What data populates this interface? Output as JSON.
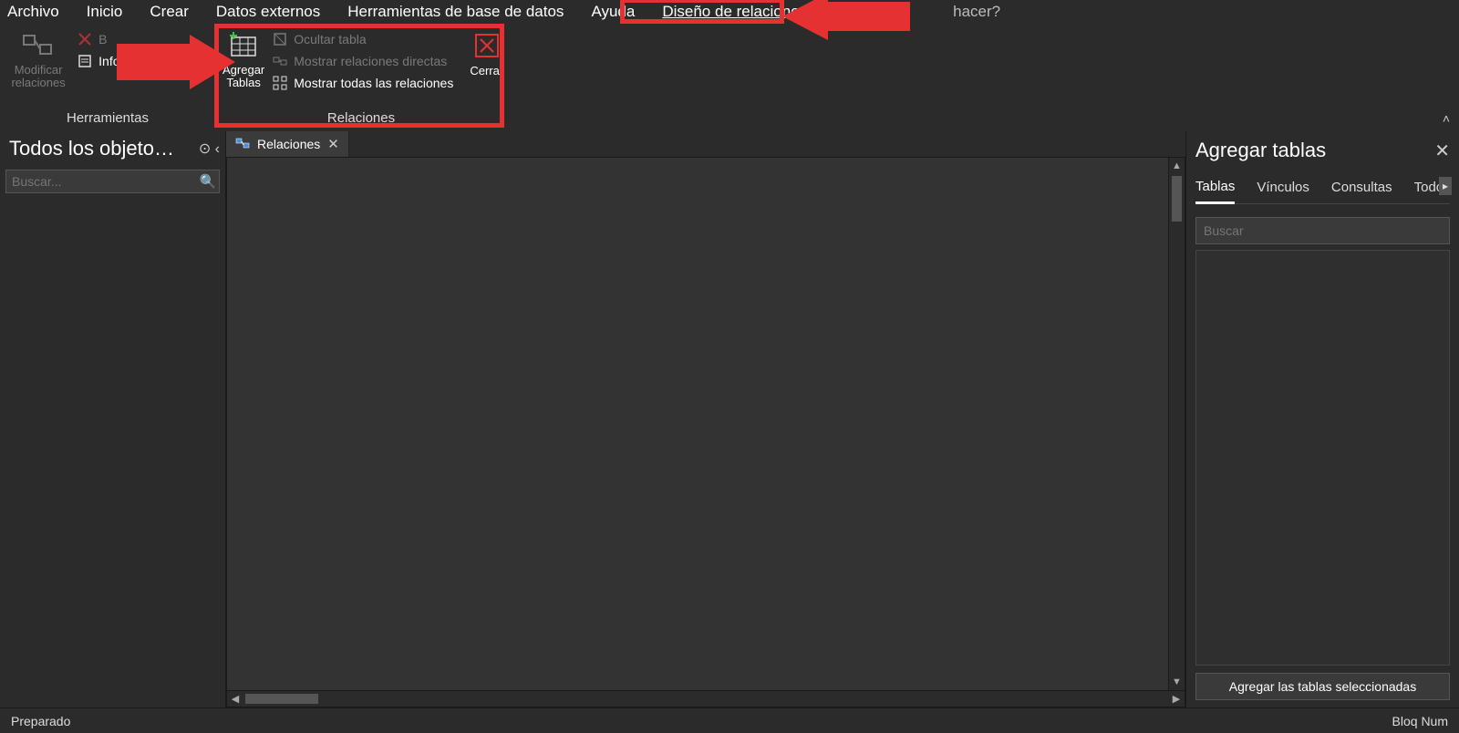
{
  "menu": {
    "items": [
      "Archivo",
      "Inicio",
      "Crear",
      "Datos externos",
      "Herramientas de base de datos",
      "Ayuda",
      "Diseño de relaciones"
    ],
    "active_index": 6,
    "tell_me_suffix": "hacer?"
  },
  "ribbon": {
    "collapse_glyph": "˄",
    "tools_group": {
      "title": "Herramientas",
      "modify_label": "Modificar\nrelaciones",
      "clear_label_prefix": "B",
      "report_label": "Informe de relación"
    },
    "relations_group": {
      "title": "Relaciones",
      "add_tables_label": "Agregar\nTablas",
      "hide_table_label": "Ocultar tabla",
      "show_direct_label": "Mostrar relaciones directas",
      "show_all_label": "Mostrar todas las relaciones",
      "close_label": "Cerrar"
    }
  },
  "nav_pane": {
    "title": "Todos los objeto…",
    "search_placeholder": "Buscar..."
  },
  "document": {
    "tab_title": "Relaciones"
  },
  "right_pane": {
    "title": "Agregar tablas",
    "tabs": [
      "Tablas",
      "Vínculos",
      "Consultas",
      "Todo"
    ],
    "active_tab_index": 0,
    "search_placeholder": "Buscar",
    "add_selected_label": "Agregar las tablas seleccionadas"
  },
  "statusbar": {
    "left": "Preparado",
    "right": "Bloq Num"
  },
  "annotations": {
    "arrow1_target": "relations_group",
    "arrow2_target": "design_relations_tab"
  }
}
